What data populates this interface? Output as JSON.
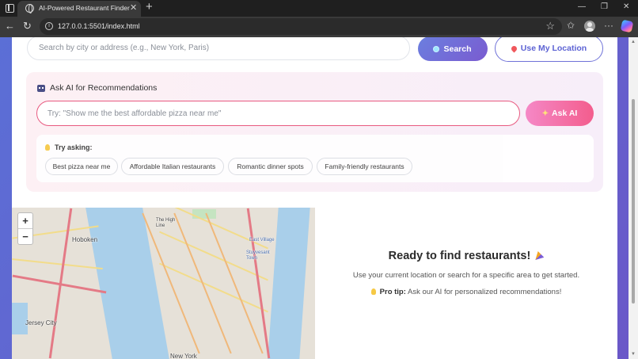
{
  "browser": {
    "tab_title": "AI-Powered Restaurant Finder",
    "url": "127.0.0.1:5501/index.html"
  },
  "search": {
    "placeholder": "Search by city or address (e.g., New York, Paris)",
    "search_label": "Search",
    "location_label": "Use My Location"
  },
  "ai": {
    "heading": "Ask AI for Recommendations",
    "input_placeholder": "Try: \"Show me the best affordable pizza near me\"",
    "ask_label": "Ask AI",
    "try_heading": "Try asking:",
    "suggestions": [
      "Best pizza near me",
      "Affordable Italian restaurants",
      "Romantic dinner spots",
      "Family-friendly restaurants"
    ]
  },
  "map": {
    "zoom_in": "+",
    "zoom_out": "−",
    "labels": {
      "hoboken": "Hoboken",
      "the_high_line": "The High\nLine",
      "east_village": "East Village",
      "jersey_city": "Jersey City",
      "stuy_town": "Stuyvesant\nTown",
      "new_york": "New York"
    }
  },
  "results": {
    "title": "Ready to find restaurants!",
    "subtitle": "Use your current location or search for a specific area to get started.",
    "tip_label": "Pro tip:",
    "tip_text": " Ask our AI for personalized recommendations!"
  },
  "colors": {
    "page_gradient_start": "#5b6fd6",
    "page_gradient_end": "#6a58c8",
    "ai_accent": "#e85a80",
    "primary": "#6b7fdf"
  },
  "icons": {
    "search_button": "dot-icon",
    "location_button": "pin-icon",
    "ai_heading": "robot-icon",
    "ask_button": "sparkle-icon",
    "tips": "bulb-icon",
    "title": "party-icon"
  }
}
